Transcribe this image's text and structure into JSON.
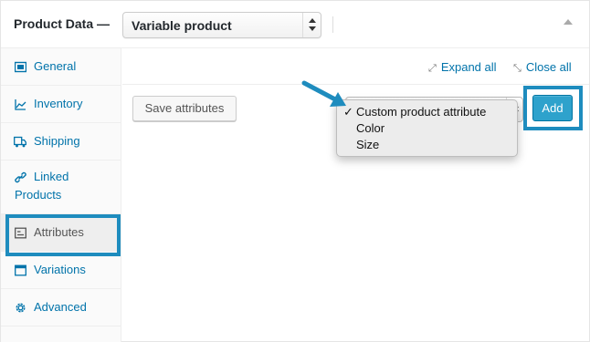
{
  "header": {
    "title": "Product Data —",
    "product_type": "Variable product"
  },
  "sidebar": {
    "items": [
      {
        "label": "General",
        "icon": "general-icon"
      },
      {
        "label": "Inventory",
        "icon": "inventory-icon"
      },
      {
        "label": "Shipping",
        "icon": "truck-icon"
      },
      {
        "label": "Linked Products",
        "icon": "link-icon"
      },
      {
        "label": "Attributes",
        "icon": "attributes-icon",
        "active": true
      },
      {
        "label": "Variations",
        "icon": "variations-icon"
      },
      {
        "label": "Advanced",
        "icon": "gear-icon"
      }
    ]
  },
  "main": {
    "expand_all": "Expand all",
    "close_all": "Close all",
    "save_attributes": "Save attributes",
    "add": "Add",
    "attribute_options": [
      {
        "label": "Custom product attribute",
        "selected": true
      },
      {
        "label": "Color",
        "selected": false
      },
      {
        "label": "Size",
        "selected": false
      }
    ]
  },
  "colors": {
    "link": "#0073aa",
    "highlight": "#1e8cbe",
    "primary_button": "#2ea2cc"
  }
}
